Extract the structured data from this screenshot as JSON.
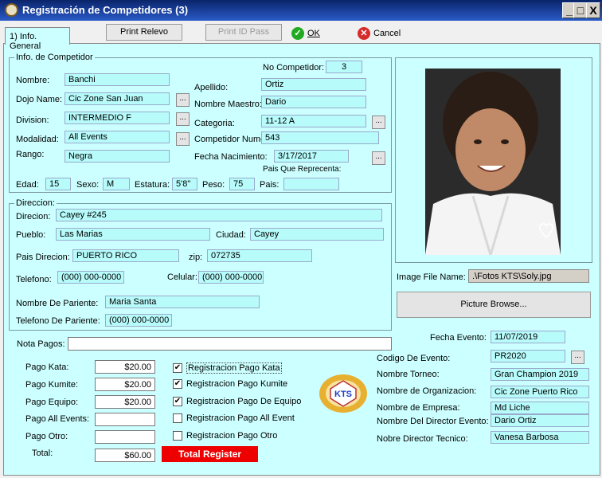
{
  "window": {
    "title": "Registración de Competidores  (3)",
    "min": "_",
    "max": "□",
    "close": "X"
  },
  "tab": {
    "label": "1) Info. General"
  },
  "toolbar": {
    "print_relevo": "Print Relevo",
    "print_id": "Print ID Pass",
    "ok": "OK",
    "cancel": "Cancel"
  },
  "competitor": {
    "group": "Info. de Competidor",
    "no_label": "No Competidor:",
    "no": "3",
    "nombre_label": "Nombre:",
    "nombre": "Banchi",
    "apellido_label": "Apellido:",
    "apellido": "Ortiz",
    "dojo_label": "Dojo Name:",
    "dojo": "Cic Zone San Juan",
    "maestro_label": "Nombre Maestro:",
    "maestro": "Dario",
    "division_label": "Division:",
    "division": "INTERMEDIO F",
    "categoria_label": "Categoria:",
    "categoria": "11-12 A",
    "modalidad_label": "Modalidad:",
    "modalidad": "All Events",
    "numero_label": "Competidor Numero:",
    "numero": "543",
    "rango_label": "Rango:",
    "rango": "Negra",
    "nacimiento_label": "Fecha Nacimiento:",
    "nacimiento": "3/17/2017",
    "pais_rep_label": "Pais Que Reprecenta:",
    "edad_label": "Edad:",
    "edad": "15",
    "sexo_label": "Sexo:",
    "sexo": "M",
    "estatura_label": "Estatura:",
    "estatura": "5'8\"",
    "peso_label": "Peso:",
    "peso": "75",
    "pais_label": "Pais:",
    "pais": ""
  },
  "address": {
    "group": "Direccion:",
    "direcion_label": "Direcion:",
    "direcion": "Cayey #245",
    "pueblo_label": "Pueblo:",
    "pueblo": "Las Marias",
    "ciudad_label": "Ciudad:",
    "ciudad": "Cayey",
    "pais_label": "Pais Direcion:",
    "pais": "PUERTO RICO",
    "zip_label": "zip:",
    "zip": "072735",
    "telefono_label": "Telefono:",
    "telefono": "(000) 000-0000",
    "celular_label": "Celular:",
    "celular": "(000) 000-0000",
    "pariente_label": "Nombre De Pariente:",
    "pariente": "Maria Santa",
    "tel_pariente_label": "Telefono De Pariente:",
    "tel_pariente": "(000) 000-0000"
  },
  "image": {
    "file_label": "Image File Name:",
    "file": ".\\Fotos KTS\\Soly.jpg",
    "browse": "Picture Browse..."
  },
  "payments": {
    "nota_label": "Nota Pagos:",
    "nota": "",
    "kata_label": "Pago Kata:",
    "kata": "$20.00",
    "kumite_label": "Pago Kumite:",
    "kumite": "$20.00",
    "equipo_label": "Pago Equipo:",
    "equipo": "$20.00",
    "all_label": "Pago All Events:",
    "all": "",
    "otro_label": "Pago Otro:",
    "otro": "",
    "total_label": "Total:",
    "total": "$60.00",
    "total_button": "Total Register",
    "checks": [
      {
        "label": "Registracion Pago Kata",
        "checked": true
      },
      {
        "label": "Registracion Pago Kumite",
        "checked": true
      },
      {
        "label": "Registracion Pago De Equipo",
        "checked": true
      },
      {
        "label": "Registracion Pago All Event",
        "checked": false
      },
      {
        "label": "Registracion Pago Otro",
        "checked": false
      }
    ],
    "check_mark": "✔",
    "logo_text": "KTS"
  },
  "event": {
    "fecha_label": "Fecha Evento:",
    "fecha": "11/07/2019",
    "codigo_label": "Codigo De Evento:",
    "codigo": "PR2020",
    "torneo_label": "Nombre Torneo:",
    "torneo": "Gran Champion 2019",
    "org_label": "Nombre de Organizacion:",
    "org": "Cic Zone Puerto Rico",
    "empresa_label": "Nombre de Empresa:",
    "empresa": "Md Liche",
    "director_label": "Nombre Del Director Evento:",
    "director": "Dario Ortiz",
    "tecnico_label": "Nobre Director Tecnico:",
    "tecnico": "Vanesa Barbosa"
  },
  "ellipsis": "...",
  "colors": {
    "panel": "#ccffff",
    "field": "#b7fbfb",
    "title": "#0a246a",
    "total_button": "#ee0000"
  }
}
